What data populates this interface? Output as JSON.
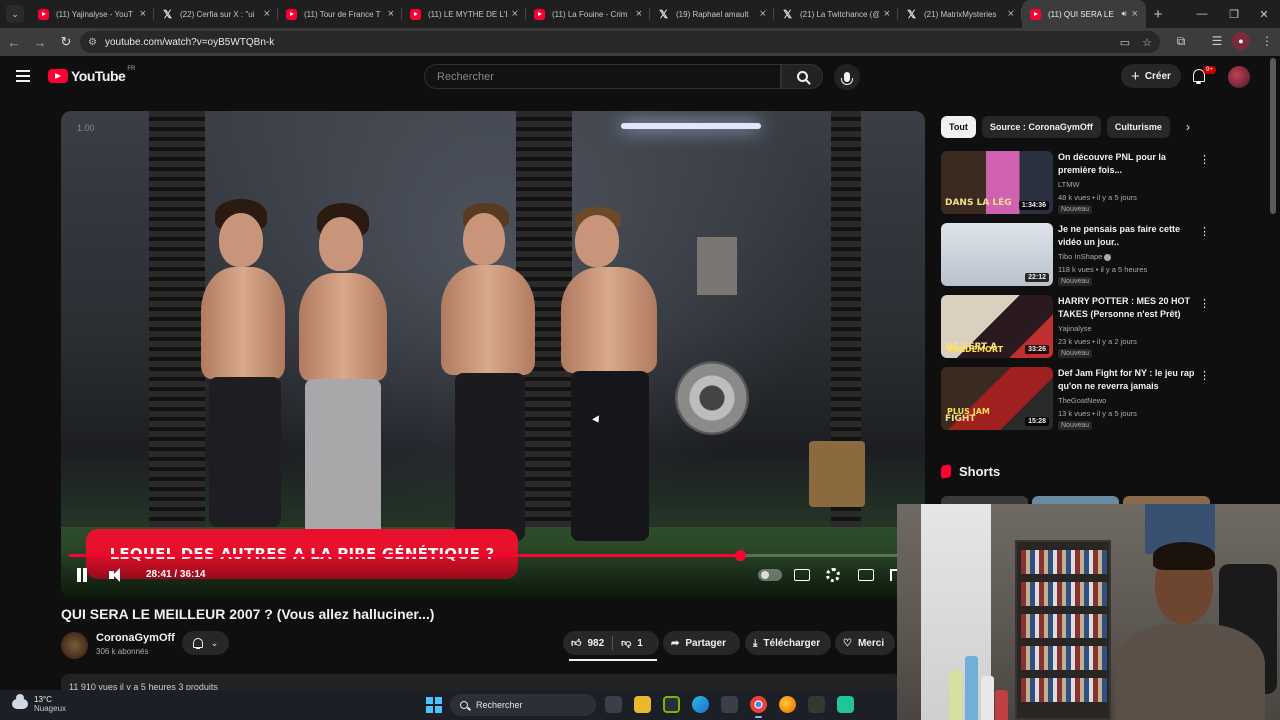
{
  "browser": {
    "tabs": [
      {
        "title": "(11) Yajinalyse - YouT",
        "favicon": "youtube-icon",
        "active": false
      },
      {
        "title": "(22) Cerfia sur X : \"ui",
        "favicon": "x-icon",
        "active": false
      },
      {
        "title": "(11) Tour de France T",
        "favicon": "youtube-icon",
        "active": false
      },
      {
        "title": "(11) LE MYTHE DE L'E",
        "favicon": "youtube-icon",
        "active": false
      },
      {
        "title": "(11) La Fouine - Crim",
        "favicon": "youtube-icon",
        "active": false
      },
      {
        "title": "(19) Raphael amault",
        "favicon": "x-icon",
        "active": false
      },
      {
        "title": "(21) La Twitchance (@",
        "favicon": "x-icon",
        "active": false
      },
      {
        "title": "(21) MatrixMysteries",
        "favicon": "x-icon",
        "active": false
      },
      {
        "title": "(11) QUI SERA LE",
        "favicon": "youtube-icon",
        "active": true
      }
    ],
    "url": "youtube.com/watch?v=oyB5WTQBn-k"
  },
  "yt_header": {
    "logo_text": "YouTube",
    "country": "FR",
    "search_placeholder": "Rechercher",
    "create_label": "Créer",
    "notif_count": "9+"
  },
  "player": {
    "overlay_text": "LEQUEL DES AUTRES A LA PIRE GÉNÉTIQUE ?",
    "top_timestamp": "1.00",
    "current_time": "28:41",
    "duration": "36:14",
    "time_display": "28:41 / 36:14",
    "progress_fraction": 0.7917
  },
  "video": {
    "title": "QUI SERA LE MEILLEUR 2007 ? (Vous allez halluciner...)",
    "channel": "CoronaGymOff",
    "subscribers": "306 k abonnés",
    "likes": "982",
    "dislikes": "1",
    "share_label": "Partager",
    "download_label": "Télécharger",
    "thanks_label": "Merci",
    "meta_peek": "11 910 vues  il y a 5 heures  3 produits"
  },
  "sidebar": {
    "chips": [
      {
        "label": "Tout",
        "active": true
      },
      {
        "label": "Source : CoronaGymOff",
        "active": false
      },
      {
        "label": "Culturisme",
        "active": false
      }
    ],
    "recommendations": [
      {
        "title": "On découvre PNL pour la première fois...",
        "channel": "LTMW",
        "meta": "48 k vues • il y a 5 jours",
        "badge": "Nouveau",
        "duration": "1:34:36",
        "thumb_text": "DANS LA LÉG",
        "verified": false
      },
      {
        "title": "Je ne pensais pas faire cette vidéo un jour..",
        "channel": "Tibo InShape",
        "meta": "118 k vues • il y a 5 heures",
        "badge": "Nouveau",
        "duration": "22:12",
        "thumb_text": "",
        "verified": true
      },
      {
        "title": "HARRY POTTER : MES 20 HOT TAKES (Personne n'est Prêt)",
        "channel": "Yajinalyse",
        "meta": "23 k vues • il y a 2 jours",
        "badge": "Nouveau",
        "duration": "33:26",
        "thumb_text": "NE SERT A",
        "thumb_text2": "VOLDEMORT",
        "verified": false
      },
      {
        "title": "Def Jam Fight for NY : le jeu rap qu'on ne reverra jamais",
        "channel": "TheGoatNewo",
        "meta": "13 k vues • il y a 5 jours",
        "badge": "Nouveau",
        "duration": "15:28",
        "thumb_text": "FIGHT",
        "thumb_text2": "PLUS JAM",
        "verified": false
      }
    ],
    "shorts_title": "Shorts"
  },
  "taskbar": {
    "temperature": "13°C",
    "weather": "Nuageux",
    "search_label": "Rechercher"
  },
  "colors": {
    "yt_red": "#ff0033",
    "banner_red": "#e8102a",
    "bg": "#0f0f0f",
    "win_blue": "#4cc2ff"
  }
}
